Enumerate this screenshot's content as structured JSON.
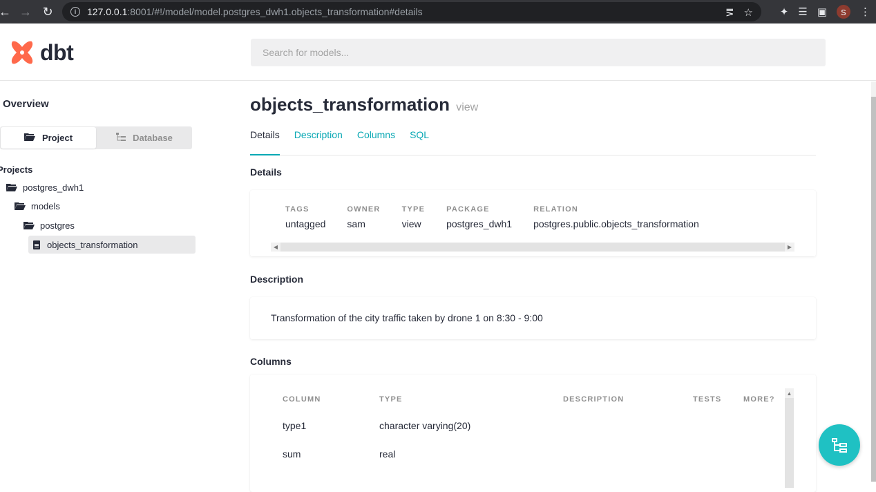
{
  "browser": {
    "url_host": "127.0.0.1",
    "url_path": ":8001/#!/model/model.postgres_dwh1.objects_transformation#details",
    "avatar_initial": "s"
  },
  "app": {
    "logo_text": "dbt",
    "search_placeholder": "Search for models...",
    "brand_color": "#ff694b",
    "accent_color": "#0aa8b4"
  },
  "sidebar": {
    "overview": "Overview",
    "toggle": {
      "project": "Project",
      "database": "Database"
    },
    "projects_label": "Projects",
    "tree": {
      "project": "postgres_dwh1",
      "models": "models",
      "postgres": "postgres",
      "model": "objects_transformation"
    }
  },
  "main": {
    "title": "objects_transformation",
    "subtitle": "view",
    "tabs": [
      "Details",
      "Description",
      "Columns",
      "SQL"
    ],
    "details_heading": "Details",
    "details": {
      "tags_label": "TAGS",
      "tags": "untagged",
      "owner_label": "OWNER",
      "owner": "sam",
      "type_label": "TYPE",
      "type": "view",
      "package_label": "PACKAGE",
      "package": "postgres_dwh1",
      "relation_label": "RELATION",
      "relation": "postgres.public.objects_transformation"
    },
    "description_heading": "Description",
    "description": "Transformation of the city traffic taken by drone 1 on 8:30 - 9:00",
    "columns_heading": "Columns",
    "columns": {
      "headers": [
        "COLUMN",
        "TYPE",
        "DESCRIPTION",
        "TESTS",
        "MORE?"
      ],
      "rows": [
        {
          "name": "type1",
          "type": "character varying(20)"
        },
        {
          "name": "sum",
          "type": "real"
        }
      ]
    }
  }
}
